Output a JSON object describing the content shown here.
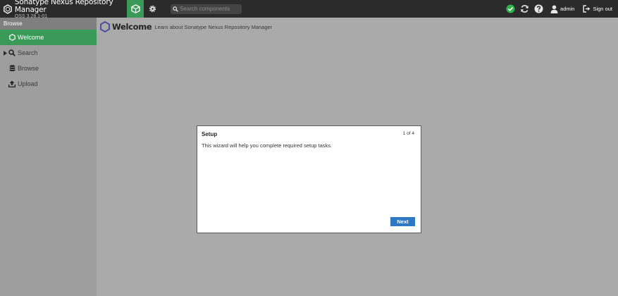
{
  "app": {
    "title": "Sonatype Nexus Repository Manager",
    "version": "OSS 3.28.1-01"
  },
  "header": {
    "search_placeholder": "Search components",
    "user_label": "admin",
    "signout_label": "Sign out"
  },
  "sidebar": {
    "heading": "Browse",
    "items": [
      {
        "label": "Welcome",
        "icon": "hexagon-icon",
        "active": true
      },
      {
        "label": "Search",
        "icon": "search-icon",
        "expandable": true
      },
      {
        "label": "Browse",
        "icon": "database-icon"
      },
      {
        "label": "Upload",
        "icon": "upload-icon"
      }
    ]
  },
  "main": {
    "title": "Welcome",
    "subtitle": "Learn about Sonatype Nexus Repository Manager"
  },
  "dialog": {
    "title": "Setup",
    "step": "1 of 4",
    "body": "This wizard will help you complete required setup tasks.",
    "next_label": "Next"
  },
  "colors": {
    "header_bg": "#2b2b2b",
    "accent_green": "#3a9a58",
    "status_ok": "#2fb34a",
    "primary_button": "#2f78c4",
    "overlay": "#aaaaaa"
  }
}
